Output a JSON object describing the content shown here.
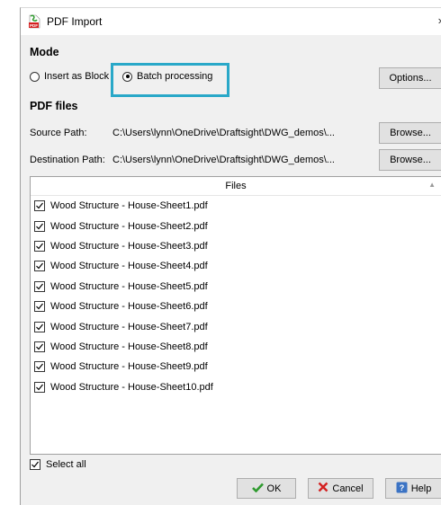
{
  "window": {
    "title": "PDF Import",
    "close_glyph": "›"
  },
  "mode": {
    "header": "Mode",
    "insert_as_block_label": "Insert as Block",
    "batch_processing_label": "Batch processing",
    "selected": "Batch processing",
    "options_label": "Options..."
  },
  "pdf_files": {
    "header": "PDF files",
    "source_path_label": "Source Path:",
    "source_path_value": "C:\\Users\\lynn\\OneDrive\\Draftsight\\DWG_demos\\...",
    "destination_path_label": "Destination Path:",
    "destination_path_value": "C:\\Users\\lynn\\OneDrive\\Draftsight\\DWG_demos\\...",
    "browse_label": "Browse..."
  },
  "files_table": {
    "column_header": "Files",
    "rows": [
      {
        "name": "Wood Structure - House-Sheet1.pdf",
        "checked": true
      },
      {
        "name": "Wood Structure - House-Sheet2.pdf",
        "checked": true
      },
      {
        "name": "Wood Structure - House-Sheet3.pdf",
        "checked": true
      },
      {
        "name": "Wood Structure - House-Sheet4.pdf",
        "checked": true
      },
      {
        "name": "Wood Structure - House-Sheet5.pdf",
        "checked": true
      },
      {
        "name": "Wood Structure - House-Sheet6.pdf",
        "checked": true
      },
      {
        "name": "Wood Structure - House-Sheet7.pdf",
        "checked": true
      },
      {
        "name": "Wood Structure - House-Sheet8.pdf",
        "checked": true
      },
      {
        "name": "Wood Structure - House-Sheet9.pdf",
        "checked": true
      },
      {
        "name": "Wood Structure - House-Sheet10.pdf",
        "checked": true
      }
    ]
  },
  "select_all": {
    "label": "Select all",
    "checked": true
  },
  "buttons": {
    "ok_label": "OK",
    "cancel_label": "Cancel",
    "help_label": "Help"
  },
  "colors": {
    "highlight": "#29a8c8",
    "ok_check": "#2e9a2e",
    "cancel_x": "#d42020",
    "help_icon": "#3b73c4"
  }
}
